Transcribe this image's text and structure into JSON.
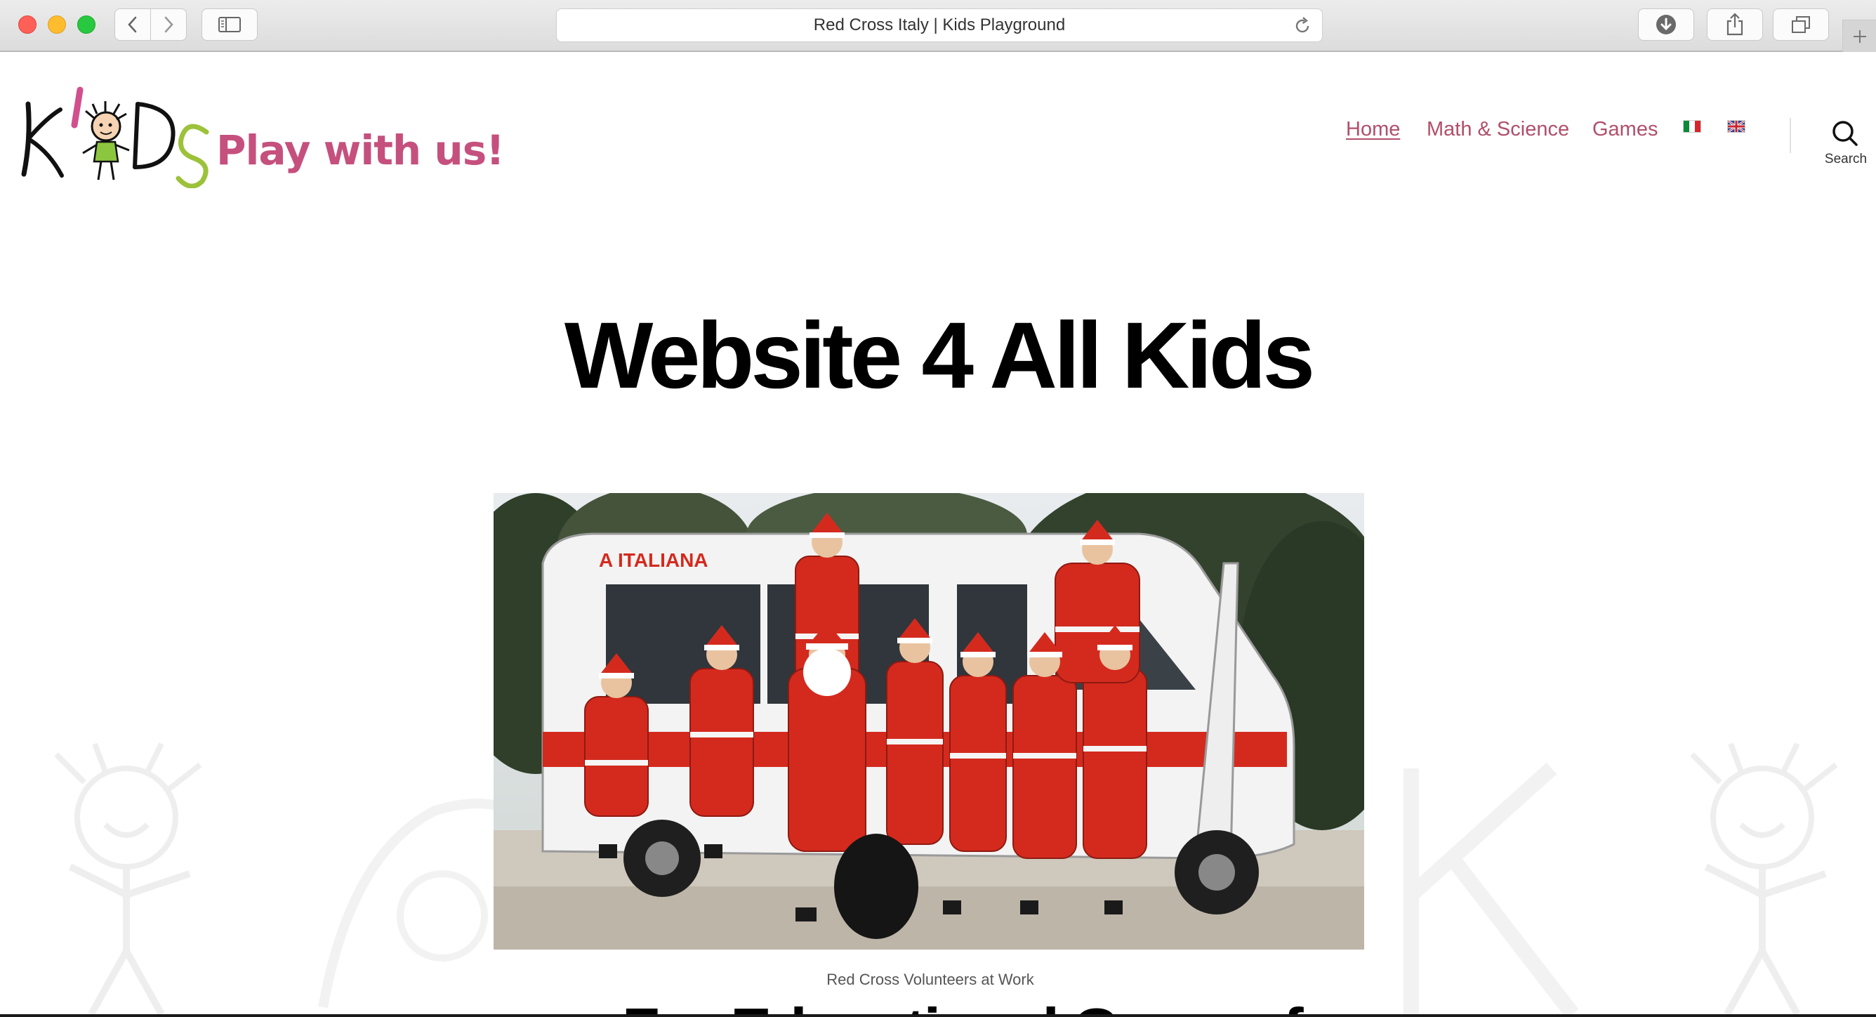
{
  "browser": {
    "tab_title": "Red Cross Italy | Kids Playground",
    "buttons": [
      "back-icon",
      "forward-icon",
      "sidebar-icon",
      "download-icon",
      "share-icon",
      "tabs-icon",
      "new-tab-icon"
    ]
  },
  "site": {
    "logo_text": "KIDS",
    "tagline": "Play with us!",
    "nav": {
      "home": "Home",
      "math": "Math & Science",
      "games": "Games"
    },
    "languages": [
      "italian-flag-icon",
      "uk-flag-icon"
    ],
    "search_label": "Search"
  },
  "main": {
    "title": "Website 4 All Kids",
    "hero_image": {
      "van_text": "A ITALIANA",
      "caption": "Red Cross Volunteers at Work"
    },
    "subheading_partial": "For Educational Games for"
  },
  "colors": {
    "nav_link": "#b14f6b",
    "tagline": "#c5507e",
    "red_cross_red": "#d42a1e"
  }
}
